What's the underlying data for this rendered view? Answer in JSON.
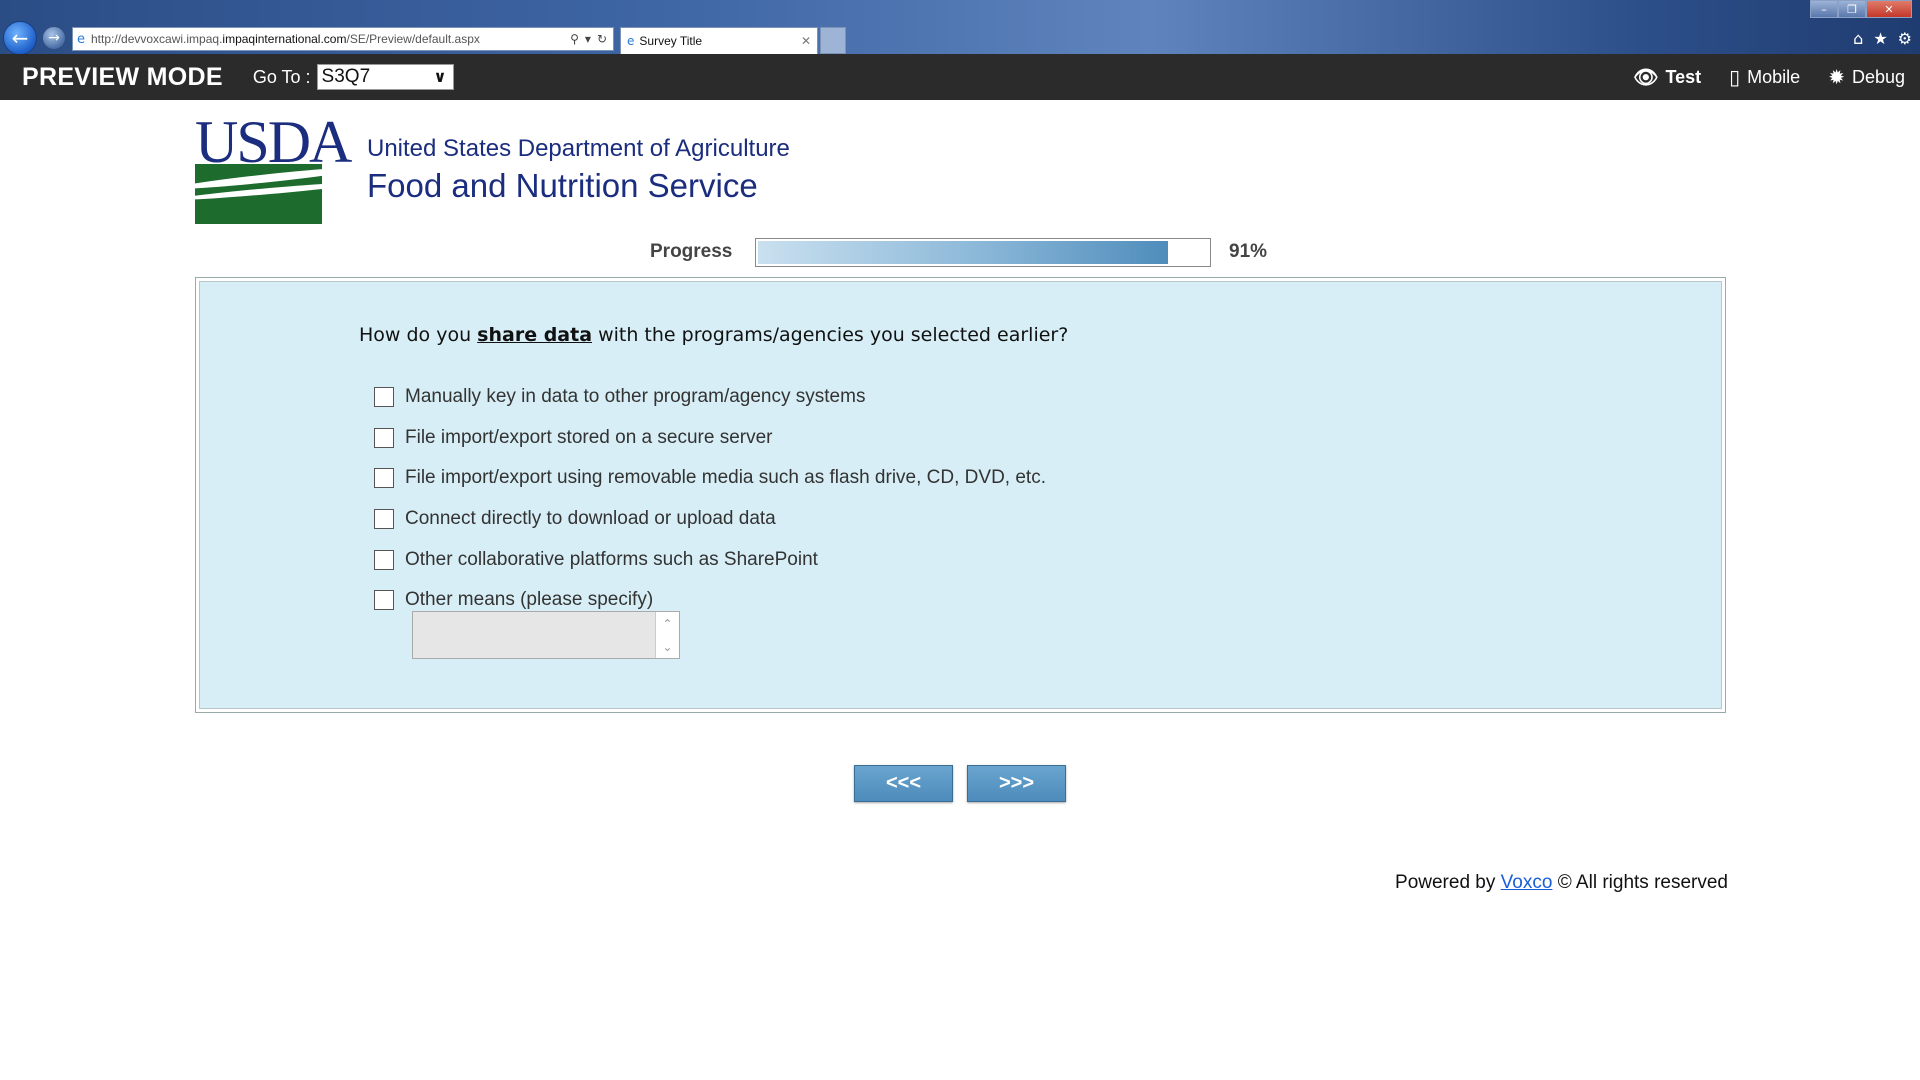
{
  "browser": {
    "url_prefix": "http://devvoxcawi.impaq.",
    "url_domain": "impaqinternational.com",
    "url_path": "/SE/Preview/default.aspx",
    "tab_title": "Survey Title",
    "icons": {
      "back": "back-arrow-icon",
      "forward": "forward-arrow-icon",
      "home": "home-icon",
      "favorites": "star-icon",
      "tools": "gear-icon"
    }
  },
  "preview_bar": {
    "title": "PREVIEW MODE",
    "goto_label": "Go To :",
    "goto_value": "S3Q7",
    "links": {
      "test": "Test",
      "mobile": "Mobile",
      "debug": "Debug"
    }
  },
  "logo": {
    "usda": "USDA",
    "line1": "United States Department of Agriculture",
    "line2": "Food and Nutrition Service"
  },
  "progress": {
    "label": "Progress",
    "percent_text": "91%",
    "value": 0.91
  },
  "question": {
    "prefix": "How do you ",
    "highlight": "share data",
    "suffix": " with the programs/agencies you selected earlier?",
    "options": [
      "Manually key in data to other program/agency systems",
      "File import/export stored on a secure server",
      "File import/export using removable media such as flash drive, CD, DVD, etc.",
      "Connect directly to download or upload data",
      "Other collaborative platforms such as SharePoint",
      "Other means (please specify)"
    ]
  },
  "nav": {
    "prev_label": "<<<",
    "next_label": ">>>"
  },
  "footer": {
    "powered_by": "Powered by ",
    "brand": "Voxco",
    "rights": " © All rights reserved"
  },
  "colors": {
    "question_bg": "#d7eef6",
    "button_blue": "#5b98c6",
    "preview_bar_bg": "#2b2b2b",
    "usda_blue": "#1b2d7e",
    "usda_green": "#1d6b2d"
  }
}
